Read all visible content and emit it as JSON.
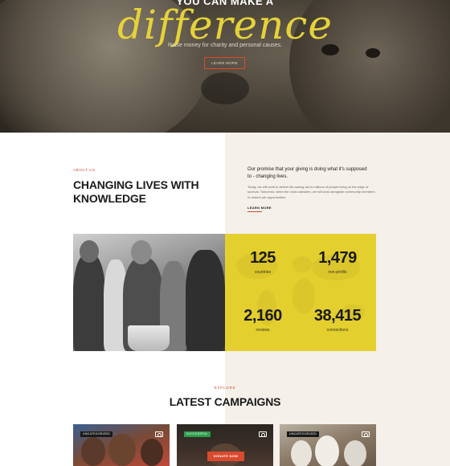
{
  "hero": {
    "eyebrow": "YOU CAN MAKE A",
    "script_title": "difference",
    "subtitle": "Raise money for charity and personal causes.",
    "cta": "LEARN MORE"
  },
  "about": {
    "eyebrow": "ABOUT US",
    "title": "CHANGING LIVES WITH KNOWLEDGE",
    "promise": "Our promise that your giving is doing what it's supposed to - changing lives.",
    "body": "Today, we will work to deliver life-saving aid to millions of people living on the edge of survival. Tomorrow, when the crisis subsides, we will work alongside community members to restore job opportunities.",
    "link": "LEARN MORE"
  },
  "stats": [
    {
      "value": "125",
      "label": "countries"
    },
    {
      "value": "1,479",
      "label": "non-profits"
    },
    {
      "value": "2,160",
      "label": "reviews"
    },
    {
      "value": "38,415",
      "label": "connections"
    }
  ],
  "campaigns": {
    "eyebrow": "EXPLORE",
    "title": "LATEST CAMPAIGNS",
    "cards": [
      {
        "badge": "UNCATEGORIZED"
      },
      {
        "badge": "SUCCESSFUL",
        "cta": "DONATE NOW"
      },
      {
        "badge": "UNCATEGORIZED"
      }
    ]
  },
  "colors": {
    "accent_red": "#d94a2e",
    "accent_yellow": "#e3cf2e",
    "script_yellow": "#e5d23a",
    "cream": "#f5f0ea",
    "badge_green": "#2e9d4d"
  },
  "icons": [
    "camera-icon"
  ]
}
